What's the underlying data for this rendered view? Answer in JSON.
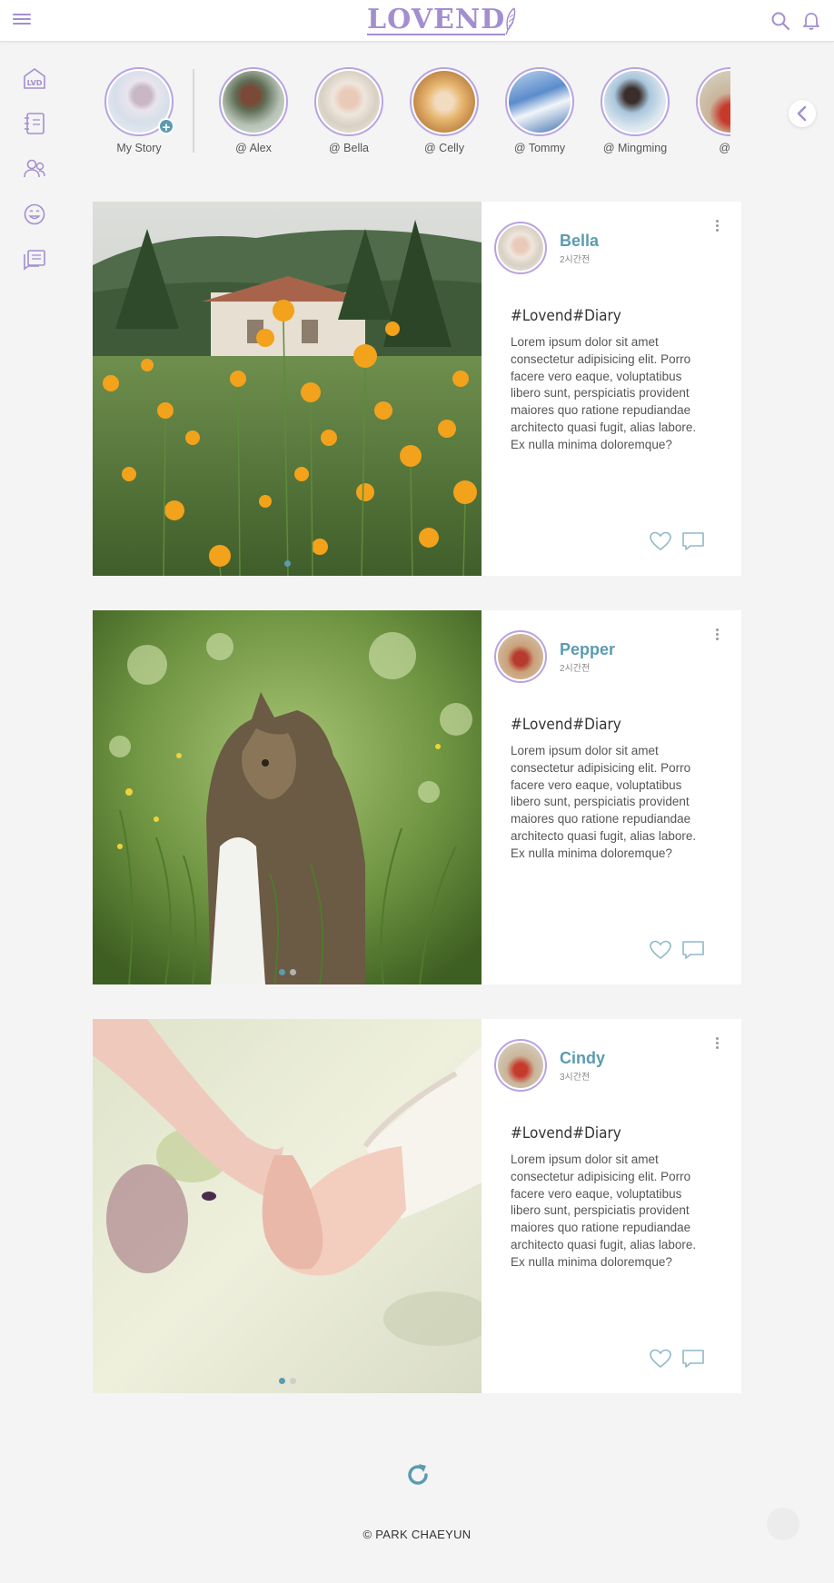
{
  "header": {
    "logo_text": "LOVEND",
    "menu_icon": "hamburger-icon",
    "search_icon": "search-icon",
    "bell_icon": "bell-icon",
    "accent_color": "#a38ed0"
  },
  "sidebar": {
    "items": [
      {
        "name": "home-icon"
      },
      {
        "name": "diary-icon"
      },
      {
        "name": "friends-icon"
      },
      {
        "name": "smile-icon"
      },
      {
        "name": "chat-list-icon"
      }
    ]
  },
  "stories": [
    {
      "label": "My Story"
    },
    {
      "label": "@ Alex"
    },
    {
      "label": "@ Bella"
    },
    {
      "label": "@ Celly"
    },
    {
      "label": "@ Tommy"
    },
    {
      "label": "@ Mingming"
    },
    {
      "label": "@ C"
    }
  ],
  "posts": [
    {
      "author": "Bella",
      "time": "2시간전",
      "hashtag": "#Lovend#Diary",
      "text": "Lorem ipsum dolor sit amet consectetur adipisicing elit. Porro facere vero eaque, voluptatibus libero sunt, perspiciatis provident maiores quo ratione repudiandae architecto quasi fugit, alias labore. Ex nulla minima doloremque?",
      "image": "orange-poppies-field",
      "slides": 1,
      "active_slide": 0
    },
    {
      "author": "Pepper",
      "time": "2시간전",
      "hashtag": "#Lovend#Diary",
      "text": "Lorem ipsum dolor sit amet consectetur adipisicing elit. Porro facere vero eaque, voluptatibus libero sunt, perspiciatis provident maiores quo ratione repudiandae architecto quasi fugit, alias labore. Ex nulla minima doloremque?",
      "image": "cat-in-grass",
      "slides": 2,
      "active_slide": 0
    },
    {
      "author": "Cindy",
      "time": "3시간전",
      "hashtag": "#Lovend#Diary",
      "text": "Lorem ipsum dolor sit amet consectetur adipisicing elit. Porro facere vero eaque, voluptatibus libero sunt, perspiciatis provident maiores quo ratione repudiandae architecto quasi fugit, alias labore. Ex nulla minima doloremque?",
      "image": "holding-hands",
      "slides": 2,
      "active_slide": 0
    }
  ],
  "icons": {
    "like": "heart-icon",
    "comment": "comment-icon",
    "refresh": "refresh-icon",
    "prev": "chevron-left-icon"
  },
  "footer": {
    "text": "© PARK CHAEYUN"
  }
}
